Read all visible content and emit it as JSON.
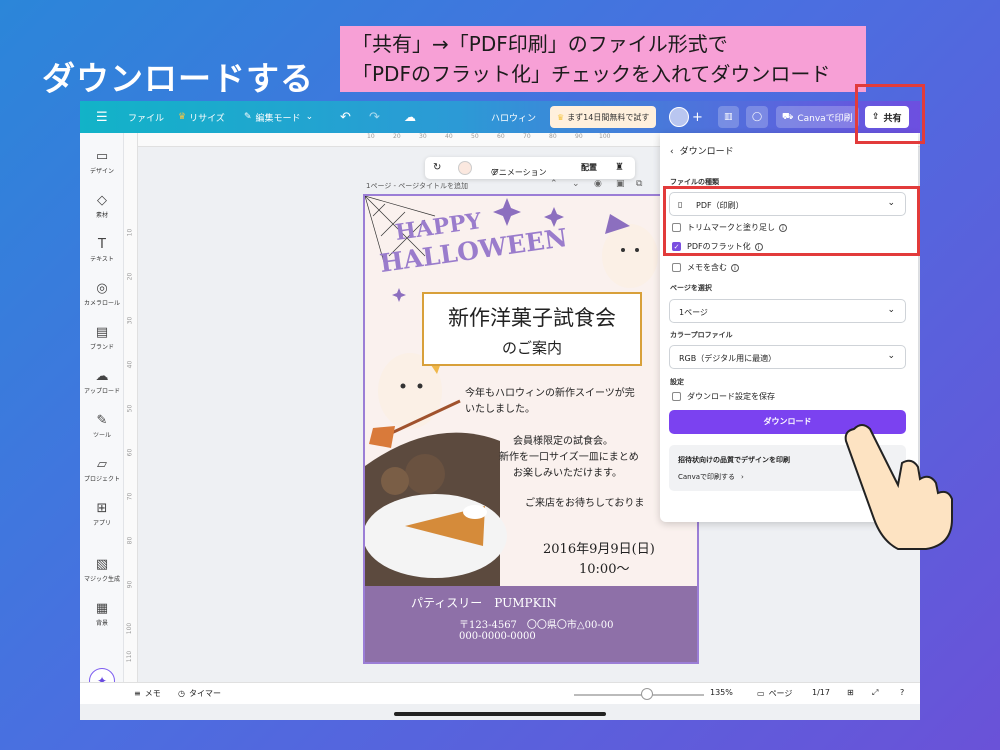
{
  "slide": {
    "title": "ダウンロードする",
    "callout_line1": "「共有」→「PDF印刷」のファイル形式で",
    "callout_line2": "「PDFのフラット化」チェックを入れてダウンロード"
  },
  "topbar": {
    "menu_icon": "hamburger-icon",
    "file": "ファイル",
    "resize": "リサイズ",
    "edit_mode": "編集モード",
    "doc_name": "ハロウィン",
    "trial": "まず14日間無料で試す",
    "print": "Canvaで印刷",
    "share": "共有"
  },
  "sidebar": [
    {
      "label": "デザイン",
      "icon": "▭"
    },
    {
      "label": "素材",
      "icon": "◇"
    },
    {
      "label": "テキスト",
      "icon": "T"
    },
    {
      "label": "カメラロール",
      "icon": "◎"
    },
    {
      "label": "ブランド",
      "icon": "▤"
    },
    {
      "label": "アップロード",
      "icon": "☁"
    },
    {
      "label": "ツール",
      "icon": "✎"
    },
    {
      "label": "プロジェクト",
      "icon": "▱"
    },
    {
      "label": "アプリ",
      "icon": "⊞"
    },
    {
      "label": "マジック生成",
      "icon": "▧"
    },
    {
      "label": "背景",
      "icon": "▦"
    }
  ],
  "canvas": {
    "ruler_h": [
      "10",
      "20",
      "30",
      "40",
      "50",
      "60",
      "70",
      "80",
      "90",
      "100"
    ],
    "ruler_v": [
      "10",
      "20",
      "30",
      "40",
      "50",
      "60",
      "70",
      "80",
      "90",
      "100",
      "110",
      "120",
      "130"
    ],
    "page_label": "1ページ - ページタイトルを追加",
    "toolbar": {
      "animation": "アニメーション",
      "arrange": "配置"
    }
  },
  "flyer": {
    "happy": "HAPPY",
    "halloween": "HALLOWEEN",
    "title": "新作洋菓子試食会",
    "subtitle": "のご案内",
    "body1": "今年もハロウィンの新作スイーツが完",
    "body2": "いたしました。",
    "body3": "会員様限定の試食会。",
    "body4": "新作を一口サイズ一皿にまとめ",
    "body5": "お楽しみいただけます。",
    "body6": "ご来店をお待ちしておりま",
    "date": "2016年9月9日(日)",
    "time": "10:00〜",
    "shop": "パティスリー　PUMPKIN",
    "address": "〒123-4567　〇〇県〇市△00-00",
    "phone": "000-0000-0000"
  },
  "download_panel": {
    "back_label": "ダウンロード",
    "file_type_label": "ファイルの種類",
    "file_type_value": "PDF（印刷）",
    "trim_marks": "トリムマークと塗り足し",
    "trim_checked": false,
    "flatten": "PDFのフラット化",
    "flatten_checked": true,
    "include_notes": "メモを含む",
    "pages_label": "ページを選択",
    "pages_value": "1ページ",
    "color_profile_label": "カラープロファイル",
    "color_profile_value": "RGB（デジタル用に最適）",
    "settings_label": "設定",
    "save_settings": "ダウンロード設定を保存",
    "download_button": "ダウンロード",
    "print_card_title": "招待状向けの品質でデザインを印刷",
    "print_card_link": "Canvaで印刷する"
  },
  "bottombar": {
    "notes": "メモ",
    "timer": "タイマー",
    "zoom": "135%",
    "pages": "ページ",
    "page_count": "1/17",
    "zoom_level_fraction": 0.56
  },
  "colors": {
    "accent_purple": "#7b42f0",
    "highlight_red": "#e23b3b",
    "callout_pink": "#f7a0d6",
    "flyer_purple": "#8e70a8"
  }
}
